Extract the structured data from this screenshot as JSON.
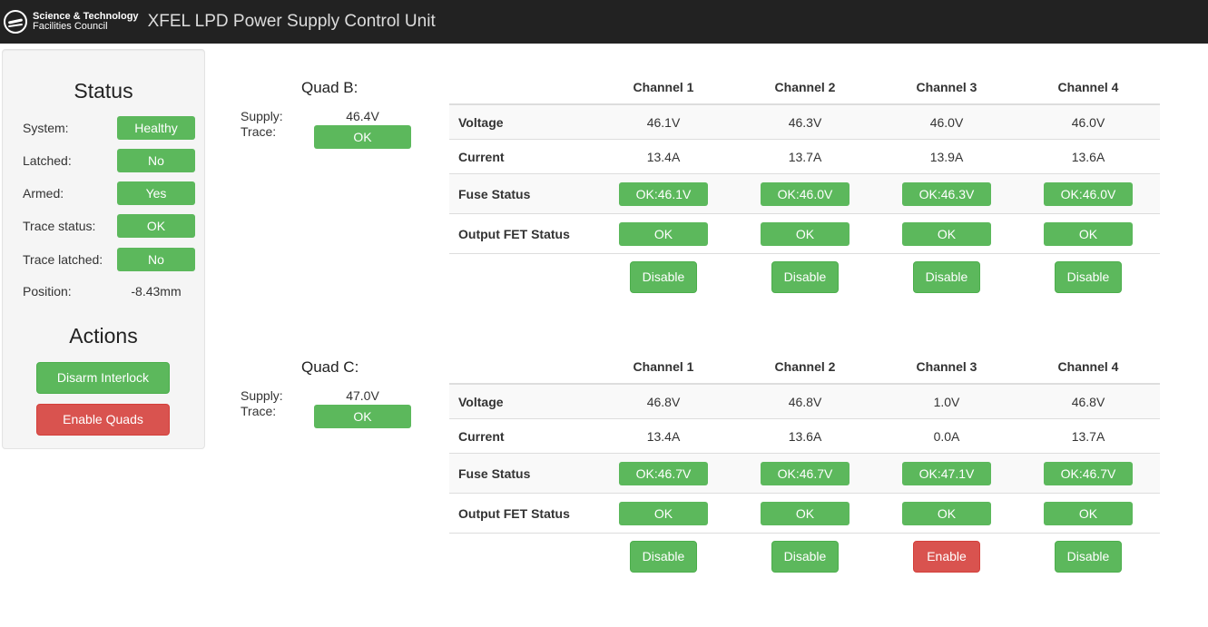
{
  "header": {
    "logo_line1": "Science & Technology",
    "logo_line2": "Facilities Council",
    "title": "XFEL LPD Power Supply Control Unit",
    "logo_icon": "stfc-logo-icon"
  },
  "status": {
    "heading": "Status",
    "rows": [
      {
        "label": "System:",
        "value": "Healthy"
      },
      {
        "label": "Latched:",
        "value": "No"
      },
      {
        "label": "Armed:",
        "value": "Yes"
      },
      {
        "label": "Trace status:",
        "value": "OK"
      },
      {
        "label": "Trace latched:",
        "value": "No"
      },
      {
        "label": "Position:",
        "value": "-8.43mm"
      }
    ]
  },
  "actions": {
    "heading": "Actions",
    "disarm_label": "Disarm Interlock",
    "enable_quads_label": "Enable Quads"
  },
  "colors": {
    "success": "#5cb85c",
    "danger": "#d9534f",
    "navbar": "#222222"
  },
  "quads": [
    {
      "title": "Quad B:",
      "supply_label": "Supply:",
      "trace_label": "Trace:",
      "supply_value": "46.4V",
      "trace_value": "OK",
      "channel_headers": [
        "Channel 1",
        "Channel 2",
        "Channel 3",
        "Channel 4"
      ],
      "row_labels": {
        "voltage": "Voltage",
        "current": "Current",
        "fuse": "Fuse Status",
        "fet": "Output FET Status"
      },
      "voltage": [
        "46.1V",
        "46.3V",
        "46.0V",
        "46.0V"
      ],
      "current": [
        "13.4A",
        "13.7A",
        "13.9A",
        "13.6A"
      ],
      "fuse": [
        "OK:46.1V",
        "OK:46.0V",
        "OK:46.3V",
        "OK:46.0V"
      ],
      "fet": [
        "OK",
        "OK",
        "OK",
        "OK"
      ],
      "buttons": [
        "Disable",
        "Disable",
        "Disable",
        "Disable"
      ]
    },
    {
      "title": "Quad C:",
      "supply_label": "Supply:",
      "trace_label": "Trace:",
      "supply_value": "47.0V",
      "trace_value": "OK",
      "channel_headers": [
        "Channel 1",
        "Channel 2",
        "Channel 3",
        "Channel 4"
      ],
      "row_labels": {
        "voltage": "Voltage",
        "current": "Current",
        "fuse": "Fuse Status",
        "fet": "Output FET Status"
      },
      "voltage": [
        "46.8V",
        "46.8V",
        "1.0V",
        "46.8V"
      ],
      "current": [
        "13.4A",
        "13.6A",
        "0.0A",
        "13.7A"
      ],
      "fuse": [
        "OK:46.7V",
        "OK:46.7V",
        "OK:47.1V",
        "OK:46.7V"
      ],
      "fet": [
        "OK",
        "OK",
        "OK",
        "OK"
      ],
      "buttons": [
        "Disable",
        "Disable",
        "Enable",
        "Disable"
      ]
    }
  ]
}
